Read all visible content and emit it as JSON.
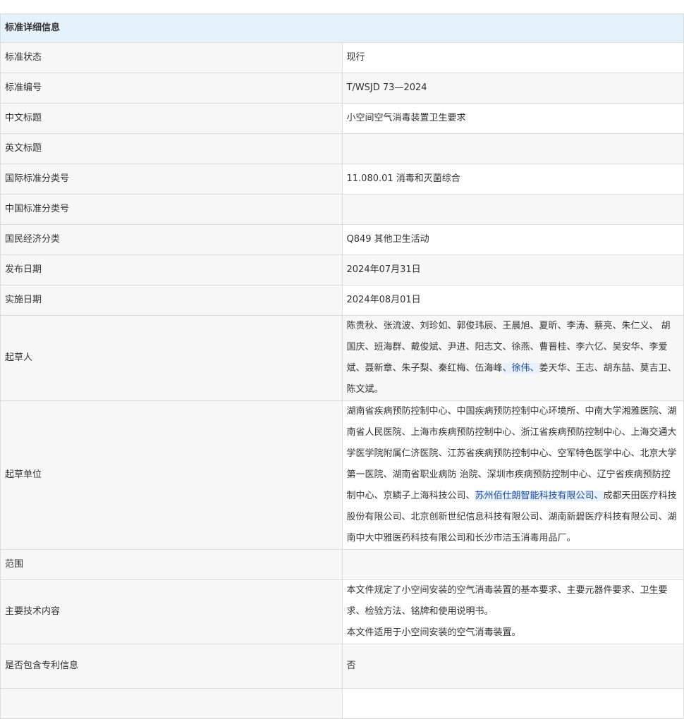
{
  "header": "标准详细信息",
  "rows": [
    {
      "label": "标准状态",
      "value": "现行"
    },
    {
      "label": "标准编号",
      "value": "T/WSJD 73—2024"
    },
    {
      "label": "中文标题",
      "value": "小空间空气消毒装置卫生要求"
    },
    {
      "label": "英文标题",
      "value": ""
    },
    {
      "label": "国际标准分类号",
      "value": "11.080.01 消毒和灭菌综合"
    },
    {
      "label": "中国标准分类号",
      "value": ""
    },
    {
      "label": "国民经济分类",
      "value": "Q849 其他卫生活动"
    },
    {
      "label": "发布日期",
      "value": "2024年07月31日"
    },
    {
      "label": "实施日期",
      "value": "2024年08月01日"
    }
  ],
  "drafters": {
    "label": "起草人",
    "before": "陈贵秋、张流波、刘珍如、郭俊玮辰、王晨旭、夏昕、李涛、蔡亮、朱仁义、 胡国庆、班海群、戴俊斌、尹进、阳志文、徐燕、曹晋桂、李六亿、吴安华、李爱斌、聂新章、朱子梨、秦红梅、伍海峰",
    "highlight": "、徐伟、",
    "after": "姜天华、王志、胡东喆、莫吉卫、陈文斌。"
  },
  "units": {
    "label": "起草单位",
    "before": "湖南省疾病预防控制中心、中国疾病预防控制中心环境所、中南大学湘雅医院、湖南省人民医院、上海市疾病预防控制中心、浙江省疾病预防控制中心、上海交通大学医学院附属仁济医院、江苏省疾病预防控制中心、空军特色医学中心、北京大学第一医院、湖南省职业病防 治院、深圳市疾病预防控制中心、辽宁省疾病预防控制中心、京鳞子上海科技公司、",
    "highlight": "苏州佰仕朗智能科技有限公司、",
    "after": "成都天田医疗科技股份有限公司、北京创新世纪信息科技有限公司、湖南新碧医疗科技有限公司、湖南中大中雅医药科技有限公司和长沙市洁玉消毒用品厂。"
  },
  "scope": {
    "label": "范围",
    "value": ""
  },
  "tech": {
    "label": "主要技术内容",
    "line1": "本文件规定了小空间安装的空气消毒装置的基本要求、主要元器件要求、卫生要求、检验方法、铭牌和使用说明书。",
    "line2": "本文件适用于小空间安装的空气消毒装置。"
  },
  "patent": {
    "label": "是否包含专利信息",
    "value": "否"
  }
}
